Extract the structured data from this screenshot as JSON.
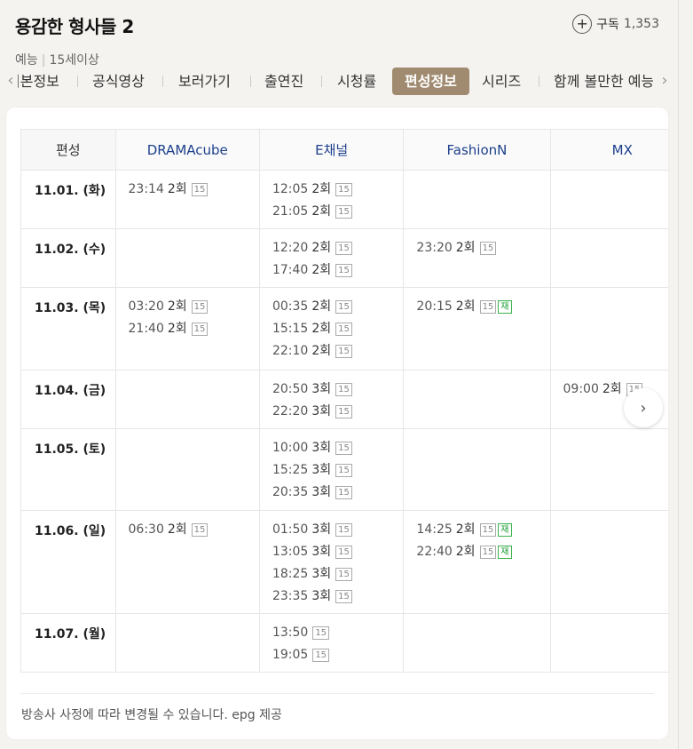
{
  "header": {
    "title": "용감한 형사들 2",
    "genre": "예능",
    "rating": "15세이상",
    "subscribe_label": "구독",
    "subscribe_count": "1,353"
  },
  "tabs": [
    {
      "label": "기본정보"
    },
    {
      "label": "공식영상"
    },
    {
      "label": "보러가기"
    },
    {
      "label": "출연진"
    },
    {
      "label": "시청률"
    },
    {
      "label": "편성정보",
      "active": true
    },
    {
      "label": "시리즈"
    },
    {
      "label": "함께 볼만한 예능"
    }
  ],
  "schedule": {
    "columns": [
      "편성",
      "DRAMAcube",
      "E채널",
      "FashionN",
      "MX"
    ],
    "rows": [
      {
        "date": "11.01. (화)",
        "cells": [
          [
            {
              "time": "23:14",
              "ep": "2회",
              "badges": [
                "15"
              ]
            }
          ],
          [
            {
              "time": "12:05",
              "ep": "2회",
              "badges": [
                "15"
              ]
            },
            {
              "time": "21:05",
              "ep": "2회",
              "badges": [
                "15"
              ]
            }
          ],
          [],
          []
        ]
      },
      {
        "date": "11.02. (수)",
        "cells": [
          [],
          [
            {
              "time": "12:20",
              "ep": "2회",
              "badges": [
                "15"
              ]
            },
            {
              "time": "17:40",
              "ep": "2회",
              "badges": [
                "15"
              ]
            }
          ],
          [
            {
              "time": "23:20",
              "ep": "2회",
              "badges": [
                "15"
              ]
            }
          ],
          []
        ]
      },
      {
        "date": "11.03. (목)",
        "cells": [
          [
            {
              "time": "03:20",
              "ep": "2회",
              "badges": [
                "15"
              ]
            },
            {
              "time": "21:40",
              "ep": "2회",
              "badges": [
                "15"
              ]
            }
          ],
          [
            {
              "time": "00:35",
              "ep": "2회",
              "badges": [
                "15"
              ]
            },
            {
              "time": "15:15",
              "ep": "2회",
              "badges": [
                "15"
              ]
            },
            {
              "time": "22:10",
              "ep": "2회",
              "badges": [
                "15"
              ]
            }
          ],
          [
            {
              "time": "20:15",
              "ep": "2회",
              "badges": [
                "15",
                "재"
              ]
            }
          ],
          []
        ]
      },
      {
        "date": "11.04. (금)",
        "cells": [
          [],
          [
            {
              "time": "20:50",
              "ep": "3회",
              "badges": [
                "15"
              ]
            },
            {
              "time": "22:20",
              "ep": "3회",
              "badges": [
                "15"
              ]
            }
          ],
          [],
          [
            {
              "time": "09:00",
              "ep": "2회",
              "badges": [
                "15"
              ]
            }
          ]
        ]
      },
      {
        "date": "11.05. (토)",
        "cells": [
          [],
          [
            {
              "time": "10:00",
              "ep": "3회",
              "badges": [
                "15"
              ]
            },
            {
              "time": "15:25",
              "ep": "3회",
              "badges": [
                "15"
              ]
            },
            {
              "time": "20:35",
              "ep": "3회",
              "badges": [
                "15"
              ]
            }
          ],
          [],
          []
        ]
      },
      {
        "date": "11.06. (일)",
        "cells": [
          [
            {
              "time": "06:30",
              "ep": "2회",
              "badges": [
                "15"
              ]
            }
          ],
          [
            {
              "time": "01:50",
              "ep": "3회",
              "badges": [
                "15"
              ]
            },
            {
              "time": "13:05",
              "ep": "3회",
              "badges": [
                "15"
              ]
            },
            {
              "time": "18:25",
              "ep": "3회",
              "badges": [
                "15"
              ]
            },
            {
              "time": "23:35",
              "ep": "3회",
              "badges": [
                "15"
              ]
            }
          ],
          [
            {
              "time": "14:25",
              "ep": "2회",
              "badges": [
                "15",
                "재"
              ]
            },
            {
              "time": "22:40",
              "ep": "2회",
              "badges": [
                "15",
                "재"
              ]
            }
          ],
          []
        ]
      },
      {
        "date": "11.07. (월)",
        "cells": [
          [],
          [
            {
              "time": "13:50",
              "ep": "",
              "badges": [
                "15"
              ]
            },
            {
              "time": "19:05",
              "ep": "",
              "badges": [
                "15"
              ]
            }
          ],
          [],
          []
        ]
      }
    ]
  },
  "footer": {
    "note": "방송사 사정에 따라 변경될 수 있습니다. epg 제공"
  },
  "icons": {
    "subscribe": "plus-circle-icon",
    "tabs_prev": "chevron-left-icon",
    "tabs_next": "chevron-right-icon",
    "table_next": "chevron-right-icon"
  },
  "colors": {
    "active_tab": "#a08b70",
    "channel_header": "#1c3f8c",
    "rerun_badge": "#3cb34d"
  }
}
